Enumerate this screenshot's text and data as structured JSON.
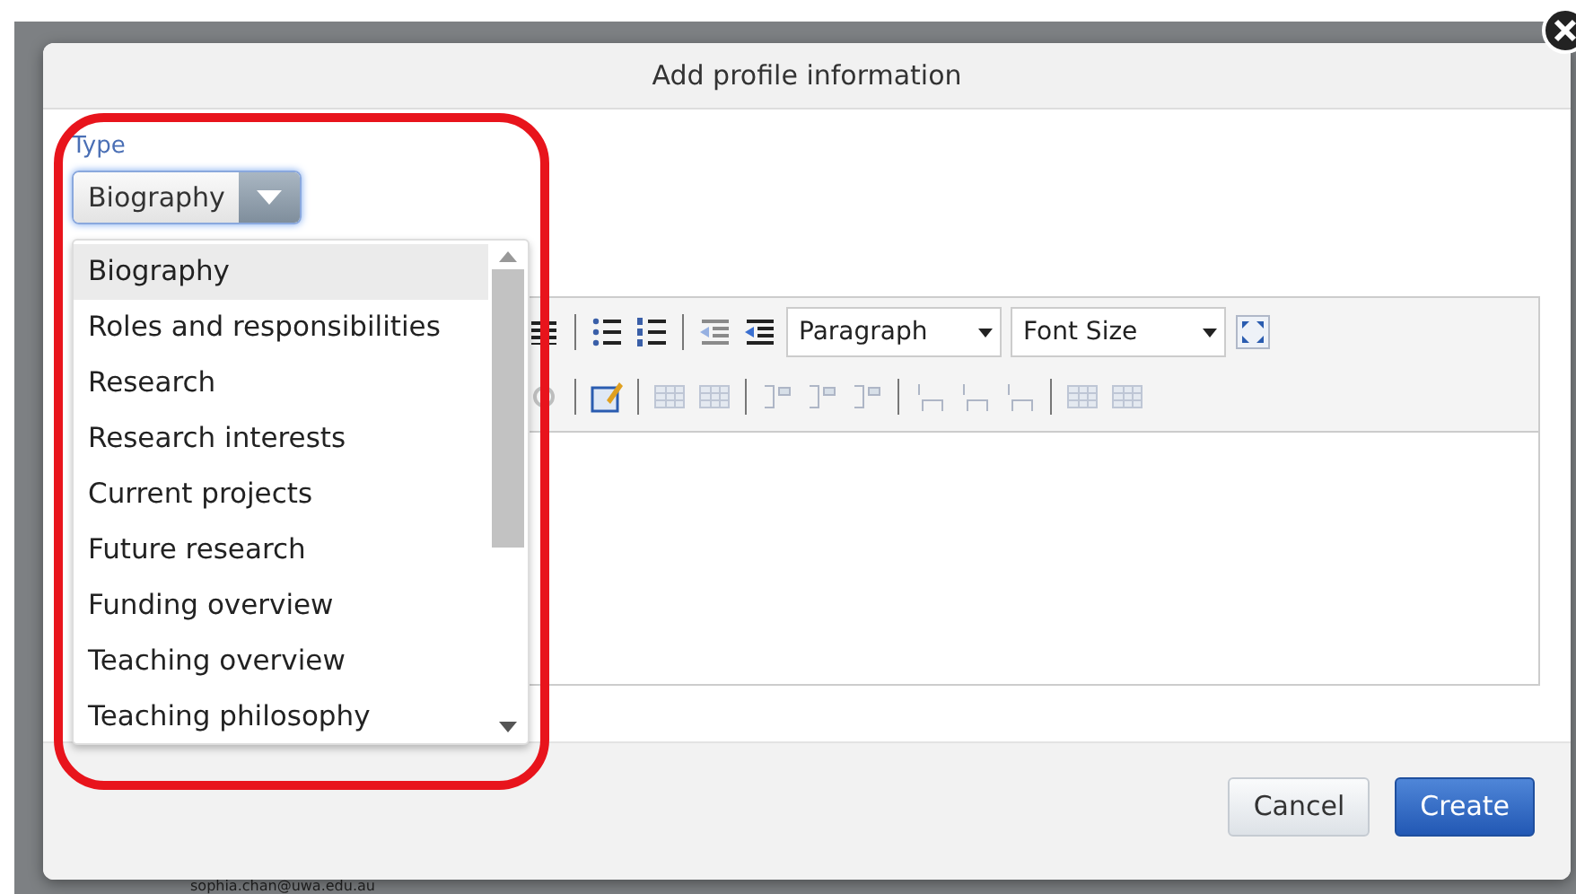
{
  "dialog": {
    "title": "Add profile information"
  },
  "type_field": {
    "label": "Type",
    "value": "Biography"
  },
  "options": [
    {
      "label": "Biography",
      "selected": true
    },
    {
      "label": "Roles and responsibilities",
      "selected": false
    },
    {
      "label": "Research",
      "selected": false
    },
    {
      "label": "Research interests",
      "selected": false
    },
    {
      "label": "Current projects",
      "selected": false
    },
    {
      "label": "Future research",
      "selected": false
    },
    {
      "label": "Funding overview",
      "selected": false
    },
    {
      "label": "Teaching overview",
      "selected": false
    },
    {
      "label": "Teaching philosophy",
      "selected": false
    }
  ],
  "toolbar_row_1": [
    {
      "kind": "justify",
      "disabled": false
    },
    {
      "kind": "separator"
    },
    {
      "kind": "bullet-list",
      "disabled": false
    },
    {
      "kind": "numbered-list",
      "disabled": false
    },
    {
      "kind": "separator"
    },
    {
      "kind": "outdent",
      "disabled": true
    },
    {
      "kind": "indent",
      "disabled": false
    },
    {
      "kind": "select",
      "label": "Paragraph"
    },
    {
      "kind": "select",
      "label": "Font Size"
    },
    {
      "kind": "fullscreen",
      "disabled": false
    }
  ],
  "toolbar_row_2": [
    {
      "kind": "unlink",
      "disabled": true
    },
    {
      "kind": "separator"
    },
    {
      "kind": "table-edit",
      "disabled": false
    },
    {
      "kind": "separator"
    },
    {
      "kind": "table-row",
      "disabled": true
    },
    {
      "kind": "table-cell",
      "disabled": true
    },
    {
      "kind": "separator"
    },
    {
      "kind": "column",
      "disabled": true
    },
    {
      "kind": "column",
      "disabled": true
    },
    {
      "kind": "column",
      "disabled": true
    },
    {
      "kind": "separator"
    },
    {
      "kind": "row",
      "disabled": true
    },
    {
      "kind": "row",
      "disabled": true
    },
    {
      "kind": "row",
      "disabled": true
    },
    {
      "kind": "separator"
    },
    {
      "kind": "table-grid",
      "disabled": true
    },
    {
      "kind": "table-grid",
      "disabled": true
    }
  ],
  "buttons": [
    {
      "label": "Cancel",
      "primary": false
    },
    {
      "label": "Create",
      "primary": true
    }
  ],
  "background_text": "sophia.chan@uwa.edu.au"
}
